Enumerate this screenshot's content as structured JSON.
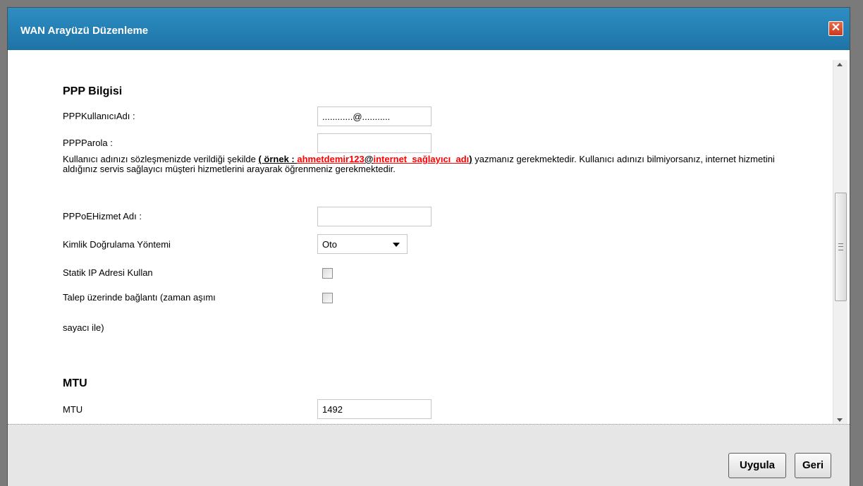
{
  "dialog": {
    "title": "WAN Arayüzü Düzenleme",
    "close_glyph": "✕"
  },
  "ppp": {
    "section_title": "PPP Bilgisi",
    "username_label": "PPPKullanıcıAdı :",
    "username_value": "............@...........",
    "password_label": "PPPParola :",
    "password_value": "",
    "note_part1": "Kullanıcı adınızı sözleşmenizde verildiği şekilde ",
    "note_example_label": "( örnek : ",
    "note_example_value": "ahmetdemir123",
    "note_example_at": "@",
    "note_example_domain": "internet_sağlayıcı_adı",
    "note_example_close": ")",
    "note_part2": " yazmanız gerekmektedir. Kullanıcı adınızı bilmiyorsanız, internet hizmetini aldığınız servis sağlayıcı müşteri hizmetlerini arayarak öğrenmeniz gerekmektedir.",
    "service_label": "PPPoEHizmet Adı :",
    "service_value": "",
    "auth_label": "Kimlik Doğrulama Yöntemi",
    "auth_value": "Oto",
    "static_ip_label": "Statik IP Adresi Kullan",
    "static_ip_checked": false,
    "on_demand_label_line1": "Talep üzerinde bağlantı (zaman aşımı",
    "on_demand_label_line2": "sayacı ile)",
    "on_demand_checked": false
  },
  "mtu": {
    "section_title": "MTU",
    "label": "MTU",
    "value": "1492"
  },
  "footer": {
    "apply_label": "Uygula",
    "back_label": "Geri"
  }
}
